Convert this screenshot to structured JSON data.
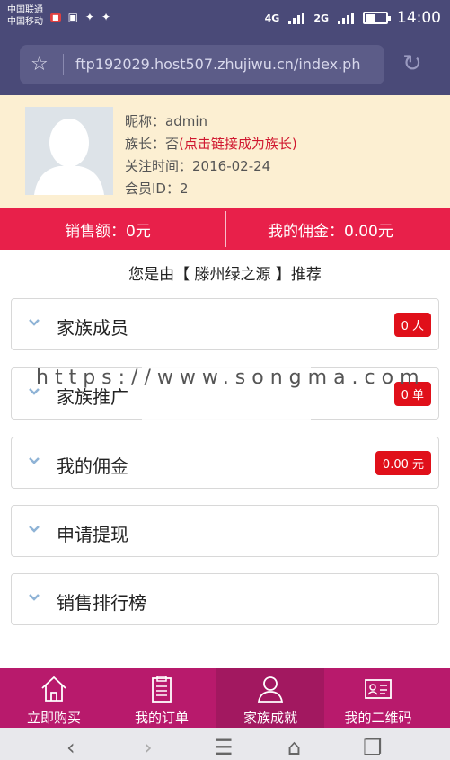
{
  "status_bar": {
    "carrier1": "中国联通",
    "carrier2": "中国移动",
    "network_a": "4G",
    "network_b": "4G",
    "network_c": "2G",
    "time": "14:00"
  },
  "browser": {
    "url": "ftp192029.host507.zhujiwu.cn/index.ph"
  },
  "profile": {
    "nickname_label": "昵称：",
    "nickname": "admin",
    "leader_label": "族长：",
    "leader_value": "否",
    "leader_link": "(点击链接成为族长)",
    "follow_label": "关注时间：",
    "follow_date": "2016-02-24",
    "member_label": "会员ID：",
    "member_id": "2"
  },
  "stats": {
    "sales": "销售额：0元",
    "commission": "我的佣金：0.00元"
  },
  "referral": "您是由【 滕州绿之源 】推荐",
  "menu": {
    "items": [
      {
        "label": "家族成员",
        "badge": "0 人"
      },
      {
        "label": "家族推广",
        "badge": "0 单"
      },
      {
        "label": "我的佣金",
        "badge": "0.00 元"
      },
      {
        "label": "申请提现"
      },
      {
        "label": "销售排行榜"
      }
    ]
  },
  "watermark": "https://www.songma.com",
  "tabbar": {
    "tabs": [
      {
        "label": "立即购买",
        "icon": "home-icon"
      },
      {
        "label": "我的订单",
        "icon": "clipboard-icon"
      },
      {
        "label": "家族成就",
        "icon": "user-icon"
      },
      {
        "label": "我的二维码",
        "icon": "id-card-icon"
      }
    ]
  },
  "colors": {
    "accent_red": "#e8204a",
    "tabbar": "#b81a6c",
    "profile_bg": "#fcefd2",
    "badge_red": "#e0101a"
  }
}
